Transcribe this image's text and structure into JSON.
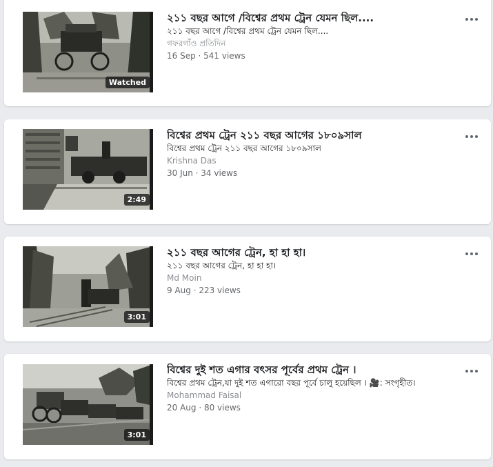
{
  "videos": [
    {
      "title": "২১১ বছর আগে /বিশ্বের প্রথম ট্রেন যেমন ছিল....",
      "description": "২১১ বছর আগে /বিশ্বের প্রথম ট্রেন যেমন ছিল....",
      "author": "গফরগাঁও প্রতিদিন",
      "meta": "16 Sep · 541 views",
      "badge": "Watched",
      "thumbnail_icon": "stagecoach-video-thumbnail"
    },
    {
      "title": "বিশ্বের প্রথম ট্রেন ২১১ বছর আগের ১৮০৯সাল",
      "description": "বিশ্বের প্রথম ট্রেন ২১১ বছর আগের ১৮০৯সাল",
      "author": "Krishna Das",
      "meta": "30 Jun · 34 views",
      "badge": "2:49",
      "thumbnail_icon": "old-locomotive-video-thumbnail"
    },
    {
      "title": "২১১ বছর আগের ট্রেন, হা হা হা।",
      "description": "২১১ বছর আগের ট্রেন, হা হা হা।",
      "author": "Md Moin",
      "meta": "9 Aug · 223 views",
      "badge": "3:01",
      "thumbnail_icon": "forest-railway-video-thumbnail"
    },
    {
      "title": "বিশ্বের দুই শত এগার বৎসর পূর্বের প্রথম ট্রেন ।",
      "description": "বিশ্বের প্রথম ট্রেন,যা দুই শত এগারো বছর পূর্বে চালু হয়েছিল । 🎥: সংগৃহীত।",
      "author": "Mohammad Faisal",
      "meta": "20 Aug · 80 views",
      "badge": "3:01",
      "thumbnail_icon": "train-cars-video-thumbnail"
    }
  ],
  "more_icon": "more-options-icon",
  "colors": {
    "background": "#e9ebee",
    "card": "#ffffff",
    "title": "#1c1e21",
    "meta": "#65676b",
    "badge_bg": "#141414"
  }
}
